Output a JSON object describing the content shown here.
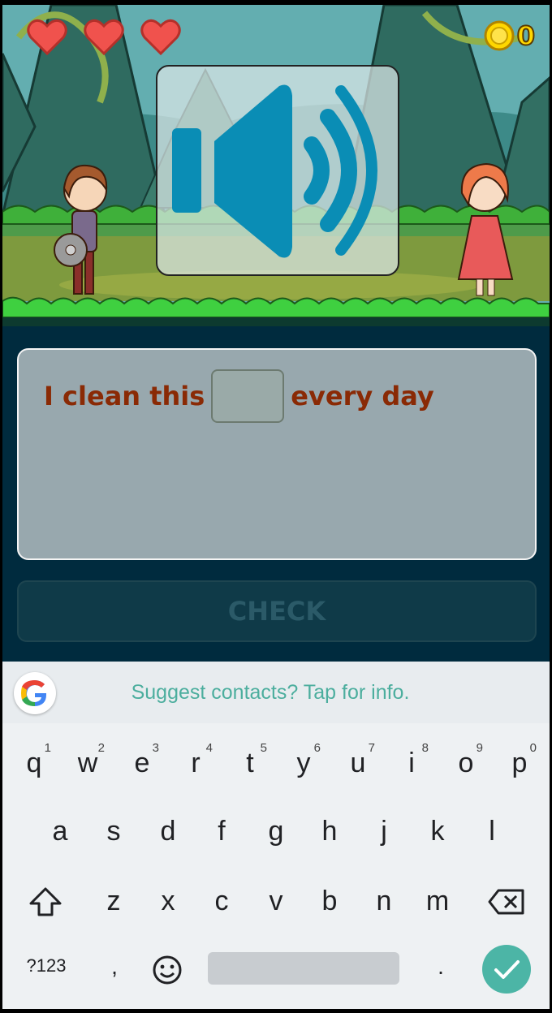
{
  "game": {
    "lives": 3,
    "coins": "0",
    "sentence": {
      "before": "I clean this",
      "after": "every day"
    },
    "check_label": "CHECK"
  },
  "keyboard": {
    "suggestion": "Suggest contacts? Tap for info.",
    "row1": [
      {
        "key": "q",
        "hint": "1"
      },
      {
        "key": "w",
        "hint": "2"
      },
      {
        "key": "e",
        "hint": "3"
      },
      {
        "key": "r",
        "hint": "4"
      },
      {
        "key": "t",
        "hint": "5"
      },
      {
        "key": "y",
        "hint": "6"
      },
      {
        "key": "u",
        "hint": "7"
      },
      {
        "key": "i",
        "hint": "8"
      },
      {
        "key": "o",
        "hint": "9"
      },
      {
        "key": "p",
        "hint": "0"
      }
    ],
    "row2": [
      "a",
      "s",
      "d",
      "f",
      "g",
      "h",
      "j",
      "k",
      "l"
    ],
    "row3": [
      "z",
      "x",
      "c",
      "v",
      "b",
      "n",
      "m"
    ],
    "symbols_label": "?123",
    "comma": ",",
    "period": "."
  },
  "colors": {
    "accent": "#4cb5a6",
    "sentence_text": "#8a2a05",
    "speaker": "#0a8db5",
    "coin": "#ffd700"
  }
}
